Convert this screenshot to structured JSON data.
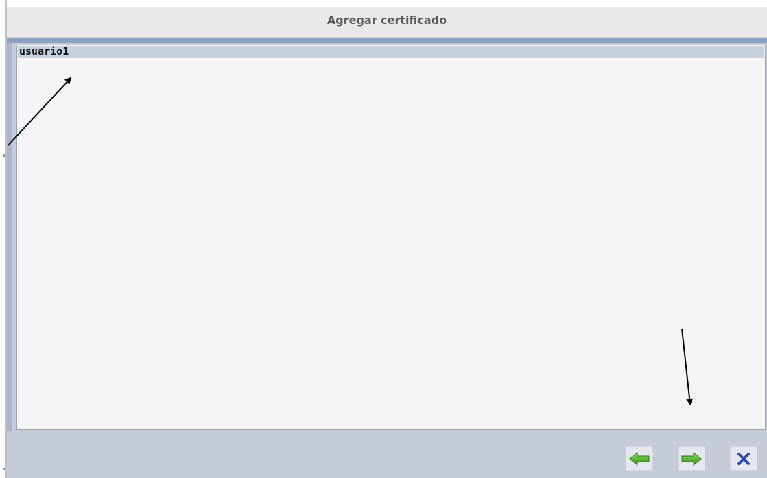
{
  "window": {
    "title": "Agregar certificado"
  },
  "list": {
    "items": [
      {
        "label": "usuario1",
        "selected": true
      }
    ]
  },
  "footer": {
    "buttons": [
      {
        "name": "back-button",
        "icon": "arrow-left-icon"
      },
      {
        "name": "next-button",
        "icon": "arrow-right-icon"
      },
      {
        "name": "close-button",
        "icon": "close-icon"
      }
    ]
  },
  "colors": {
    "title_bar": "#e8e8e8",
    "panel": "#c6ccd7",
    "selection": "#c7d0dd",
    "arrow_green": "#4caf2e",
    "close_blue": "#2d4aa8"
  }
}
